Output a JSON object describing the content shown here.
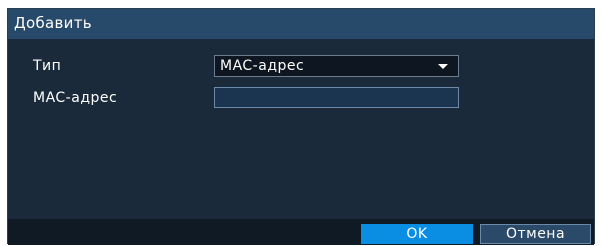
{
  "dialog": {
    "title": "Добавить",
    "fields": {
      "type_label": "Тип",
      "type_value": "MAC-адрес",
      "mac_label": "MAC-адрес",
      "mac_value": ""
    },
    "buttons": {
      "ok_label": "OK",
      "cancel_label": "Отмена"
    }
  },
  "colors": {
    "title_bar": "#284a6a",
    "body": "#1b2a3b",
    "footer": "#0f1a25",
    "ok_button": "#0a8ee4",
    "cancel_button": "#2b4a6a"
  },
  "icons": {
    "dropdown": "chevron-down-icon"
  }
}
